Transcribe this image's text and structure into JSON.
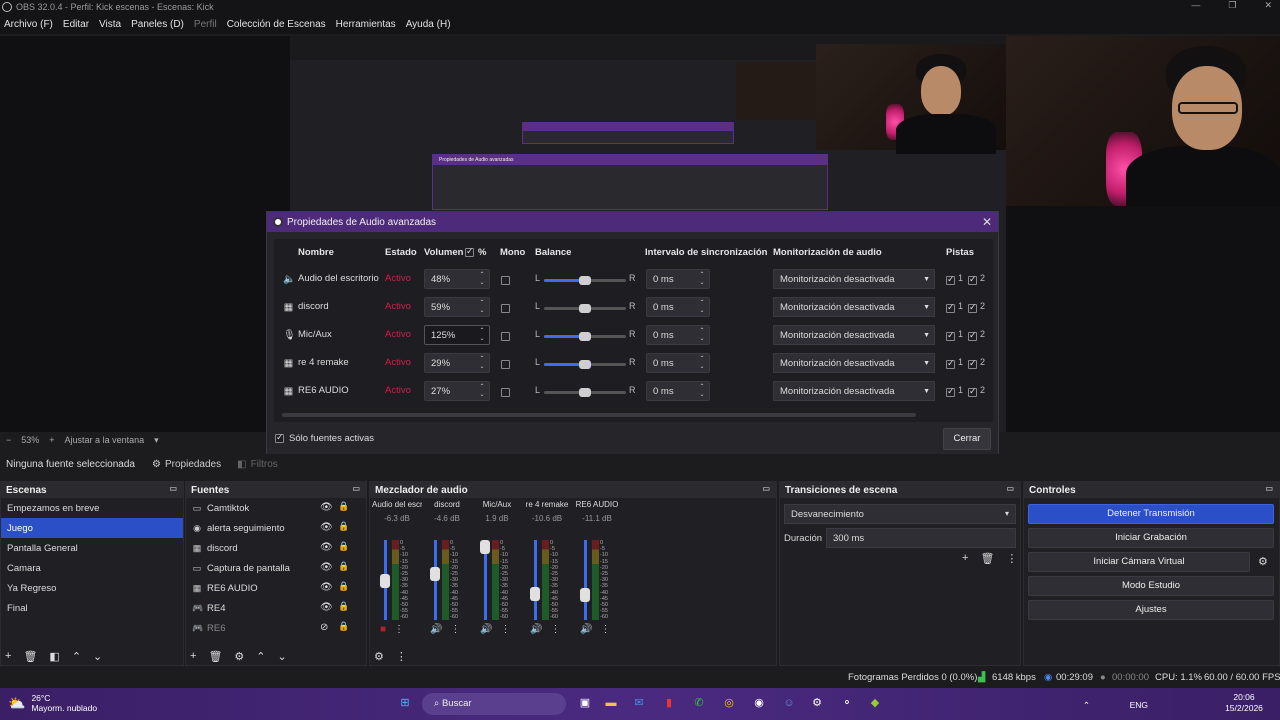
{
  "window": {
    "title": "OBS 32.0.4 - Perfil: Kick escenas - Escenas: Kick",
    "controls": [
      "—",
      "❐",
      "✕"
    ]
  },
  "menu": {
    "items": [
      "Archivo (F)",
      "Editar",
      "Vista",
      "Paneles (D)",
      "Perfil",
      "Colección de Escenas",
      "Herramientas",
      "Ayuda (H)"
    ]
  },
  "preview": {
    "zoom": "53%",
    "fit_label": "Ajustar a la ventana",
    "minus": "−",
    "plus": "+"
  },
  "nested": {
    "title1": "Propiedades de Audio avanzadas"
  },
  "dialog": {
    "title": "Propiedades de Audio avanzadas",
    "headers": {
      "name": "Nombre",
      "status": "Estado",
      "volume": "Volumen",
      "pct": "%",
      "mono": "Mono",
      "balance": "Balance",
      "sync": "Intervalo de sincronización",
      "monitor": "Monitorización de audio",
      "tracks": "Pistas"
    },
    "rows": [
      {
        "icon": "🔈",
        "name": "Audio del escritorio",
        "status": "Activo",
        "volume": "48%",
        "balance": 0.5,
        "active_balance": true,
        "sync": "0 ms",
        "monitor": "Monitorización desactivada",
        "track1": "1",
        "track2": "2"
      },
      {
        "icon": "▦",
        "name": "discord",
        "status": "Activo",
        "volume": "59%",
        "balance": 0.5,
        "active_balance": false,
        "sync": "0 ms",
        "monitor": "Monitorización desactivada",
        "track1": "1",
        "track2": "2"
      },
      {
        "icon": "🎙",
        "name": "Mic/Aux",
        "status": "Activo",
        "volume": "125%",
        "balance": 0.5,
        "active_balance": true,
        "sync": "0 ms",
        "monitor": "Monitorización desactivada",
        "track1": "1",
        "track2": "2"
      },
      {
        "icon": "▦",
        "name": "re 4 remake",
        "status": "Activo",
        "volume": "29%",
        "balance": 0.5,
        "active_balance": true,
        "sync": "0 ms",
        "monitor": "Monitorización desactivada",
        "track1": "1",
        "track2": "2"
      },
      {
        "icon": "▦",
        "name": "RE6 AUDIO",
        "status": "Activo",
        "volume": "27%",
        "balance": 0.5,
        "active_balance": false,
        "sync": "0 ms",
        "monitor": "Monitorización desactivada",
        "track1": "1",
        "track2": "2"
      }
    ],
    "lr": {
      "l": "L",
      "r": "R"
    },
    "only_active": "Sólo fuentes activas",
    "close": "Cerrar"
  },
  "propbar": {
    "no_source": "Ninguna fuente seleccionada",
    "properties": "Propiedades",
    "filters": "Filtros"
  },
  "scenes": {
    "title": "Escenas",
    "items": [
      "Empezamos en breve",
      "Juego",
      "Pantalla General",
      "Camara",
      "Ya Regreso",
      "Final"
    ],
    "active_index": 1
  },
  "sources": {
    "title": "Fuentes",
    "items": [
      {
        "icon": "▭",
        "name": "Camtiktok"
      },
      {
        "icon": "◉",
        "name": "alerta seguimiento"
      },
      {
        "icon": "▦",
        "name": "discord"
      },
      {
        "icon": "▭",
        "name": "Captura de pantalla"
      },
      {
        "icon": "▦",
        "name": "RE6 AUDIO"
      },
      {
        "icon": "🎮",
        "name": "RE4"
      },
      {
        "icon": "🎮",
        "name": "RE6"
      }
    ]
  },
  "mixer": {
    "title": "Mezclador de audio",
    "channels": [
      {
        "name": "Audio del escritorio",
        "db": "-6.3 dB",
        "level": 0.48
      },
      {
        "name": "discord",
        "db": "-4.6 dB",
        "level": 0.59
      },
      {
        "name": "Mic/Aux",
        "db": "1.9 dB",
        "level": 1.0
      },
      {
        "name": "re 4 remake",
        "db": "-10.6 dB",
        "level": 0.29
      },
      {
        "name": "RE6 AUDIO",
        "db": "-11.1 dB",
        "level": 0.27
      }
    ],
    "scale": [
      "0",
      "-5",
      "-10",
      "-15",
      "-20",
      "-25",
      "-30",
      "-35",
      "-40",
      "-45",
      "-50",
      "-55",
      "-60"
    ]
  },
  "transitions": {
    "title": "Transiciones de escena",
    "selected": "Desvanecimiento",
    "duration_label": "Duración",
    "duration_value": "300 ms"
  },
  "controls": {
    "title": "Controles",
    "buttons": [
      "Detener Transmisión",
      "Iniciar Grabación",
      "Iniciar Cámara Virtual",
      "Modo Estudio",
      "Ajustes"
    ]
  },
  "status": {
    "dropped": "Fotogramas Perdidos 0 (0.0%)",
    "kbps": "6148 kbps",
    "stream_time": "00:29:09",
    "rec_time": "00:00:00",
    "cpu": "CPU: 1.1%",
    "fps": "60.00 / 60.00 FPS"
  },
  "taskbar": {
    "temp": "26°C",
    "weather": "Mayorm. nublado",
    "search": "Buscar",
    "lang": "ENG",
    "time": "20:06",
    "date": "15/2/2026"
  },
  "colors": {
    "accent": "#2b4fc7",
    "dialog_title": "#4d2a7a",
    "status_red": "#c0264a"
  }
}
